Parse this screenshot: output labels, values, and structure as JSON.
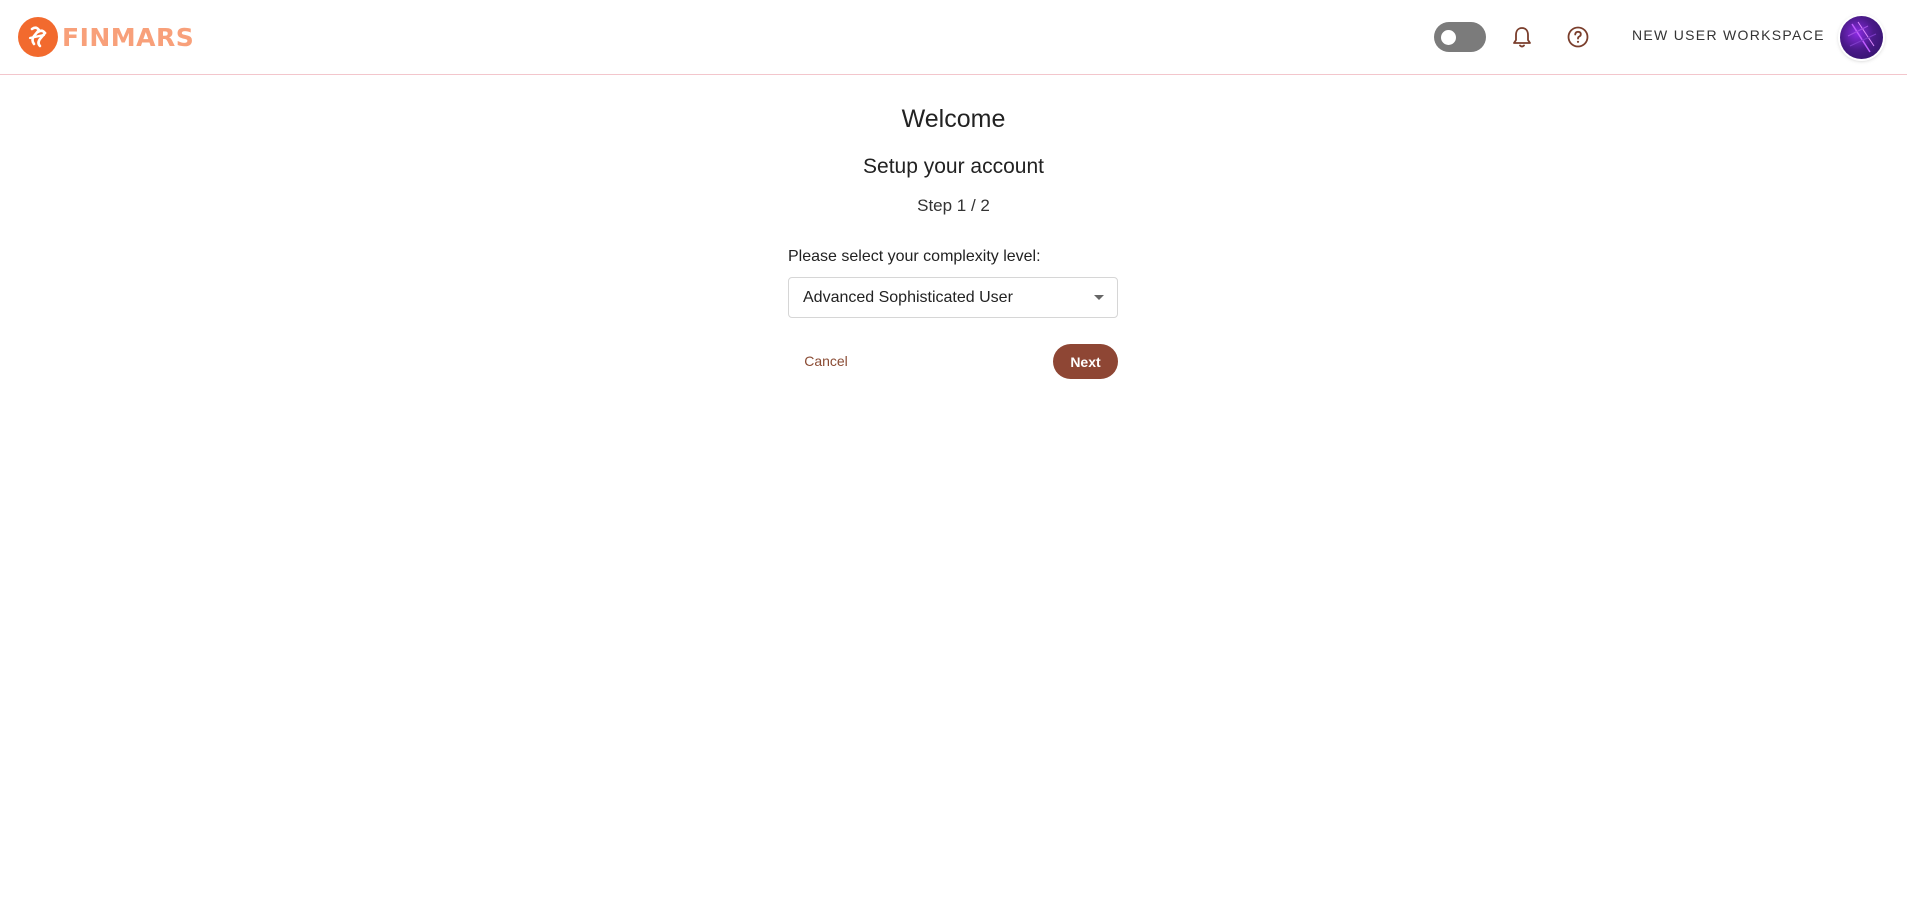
{
  "header": {
    "logo_text": "FINMARS",
    "workspace_label": "NEW USER WORKSPACE",
    "brand_color": "#f26a2e",
    "icons": [
      "logo-icon",
      "bell-icon",
      "help-icon"
    ]
  },
  "main": {
    "welcome": "Welcome",
    "subtitle": "Setup your account",
    "step": "Step 1 / 2",
    "complexity_label": "Please select your complexity level:",
    "complexity_value": "Advanced Sophisticated User",
    "cancel_label": "Cancel",
    "next_label": "Next",
    "accent_color": "#8e4634"
  }
}
